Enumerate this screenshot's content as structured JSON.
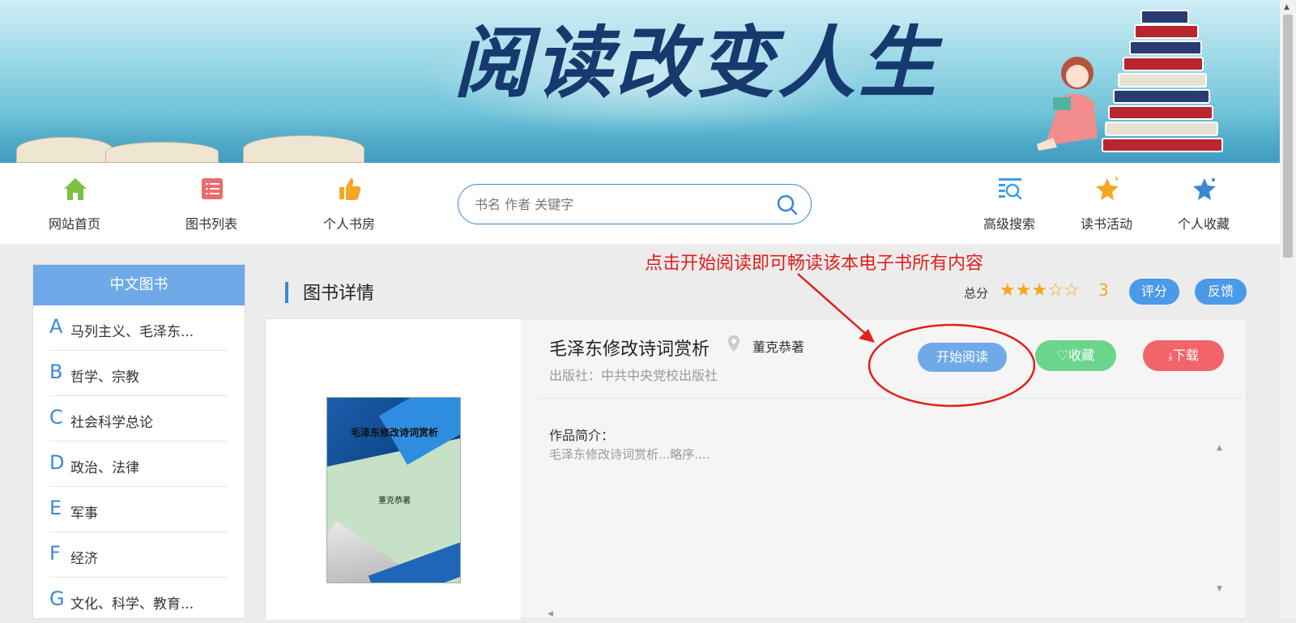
{
  "banner": {
    "slogan": "阅读改变人生"
  },
  "nav": {
    "items": [
      {
        "label": "网站首页",
        "icon": "home-icon",
        "color": "#7cc242"
      },
      {
        "label": "图书列表",
        "icon": "list-icon",
        "color": "#f06a6a"
      },
      {
        "label": "个人书房",
        "icon": "thumbs-up-icon",
        "color": "#f6a623"
      },
      {
        "label": "高级搜索",
        "icon": "advanced-search-icon",
        "color": "#3a9ee8"
      },
      {
        "label": "读书活动",
        "icon": "star-icon",
        "color": "#f6a623"
      },
      {
        "label": "个人收藏",
        "icon": "favorite-star-icon",
        "color": "#3a88d4"
      }
    ],
    "search_placeholder": "书名 作者 关键字"
  },
  "sidebar": {
    "title": "中文图书",
    "categories": [
      {
        "letter": "A",
        "name": "马列主义、毛泽东..."
      },
      {
        "letter": "B",
        "name": "哲学、宗教"
      },
      {
        "letter": "C",
        "name": "社会科学总论"
      },
      {
        "letter": "D",
        "name": "政治、法律"
      },
      {
        "letter": "E",
        "name": "军事"
      },
      {
        "letter": "F",
        "name": "经济"
      },
      {
        "letter": "G",
        "name": "文化、科学、教育..."
      }
    ]
  },
  "main": {
    "title": "图书详情",
    "score_label": "总分",
    "rating": 3,
    "rating_max": 5,
    "score_value": "3",
    "rate_button": "评分",
    "feedback_button": "反馈",
    "annotation": "点击开始阅读即可畅读该本电子书所有内容"
  },
  "book": {
    "title": "毛泽东修改诗词赏析",
    "author": "董克恭著",
    "publisher": "出版社：中共中央党校出版社",
    "read_button": "开始阅读",
    "favorite_button": "收藏",
    "download_button": "下载",
    "intro_label": "作品简介：",
    "intro_text": "毛泽东修改诗词赏析...略序....",
    "cover_title": "毛泽东修改诗词赏析",
    "cover_author": "董克恭著"
  },
  "colors": {
    "accent": "#3a88d4",
    "annotation": "#e0201c",
    "star": "#f2a81d"
  }
}
